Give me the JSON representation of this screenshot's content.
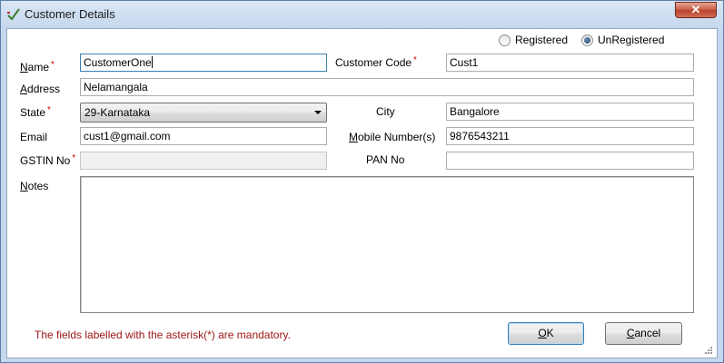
{
  "window": {
    "title": "Customer Details",
    "close_glyph": "✕"
  },
  "registration": {
    "options": [
      "Registered",
      "UnRegistered"
    ],
    "selected": "UnRegistered"
  },
  "form": {
    "name": {
      "label_mnemonic": "N",
      "label_rest": "ame",
      "required_mark": "*",
      "value": "CustomerOne"
    },
    "customer_code": {
      "label": "Customer Code",
      "required_mark": "*",
      "value": "Cust1"
    },
    "address": {
      "label_mnemonic": "A",
      "label_rest": "ddress",
      "value": "Nelamangala"
    },
    "state": {
      "label": "State",
      "required_mark": "*",
      "value": "29-Karnataka"
    },
    "city": {
      "label": "City",
      "value": "Bangalore"
    },
    "email": {
      "label": "Email",
      "value": "cust1@gmail.com"
    },
    "mobile": {
      "label_mnemonic": "M",
      "label_rest": "obile Number(s)",
      "value": "9876543211"
    },
    "gstin": {
      "label": "GSTIN No",
      "required_mark": "*",
      "value": ""
    },
    "pan": {
      "label": "PAN No",
      "value": ""
    },
    "notes": {
      "label_mnemonic": "N",
      "label_rest": "otes",
      "value": ""
    }
  },
  "footer": {
    "mandatory_message": "The fields labelled with the asterisk(*)  are mandatory.",
    "ok": {
      "mnemonic": "O",
      "rest": "K"
    },
    "cancel": {
      "mnemonic": "C",
      "rest": "ancel"
    }
  },
  "colors": {
    "required": "#d40000",
    "message": "#a01818",
    "focus_border": "#3c7fb1"
  }
}
